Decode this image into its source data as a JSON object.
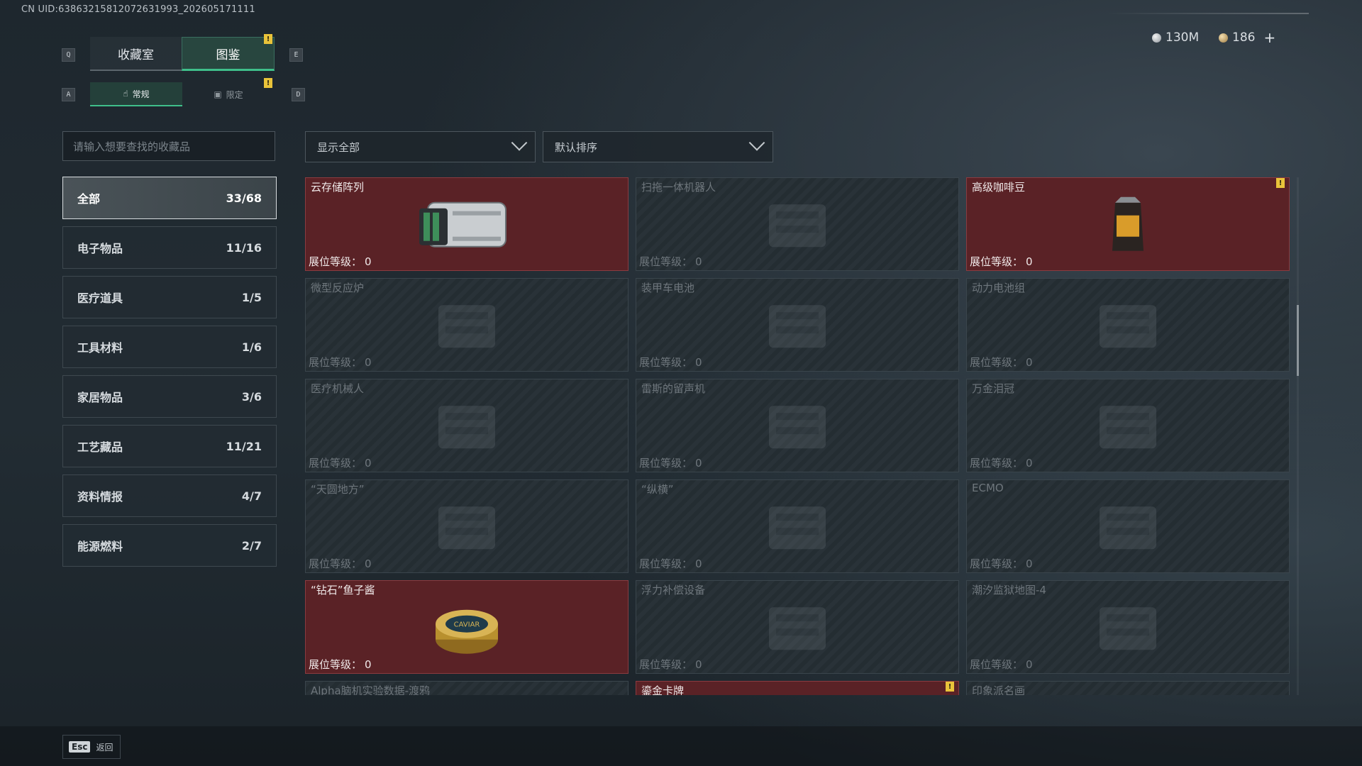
{
  "uid": "CN UID:6386321581207263199​3_202605171111",
  "currency": {
    "silver": "130M",
    "gold": "186",
    "plus": "+"
  },
  "keys": {
    "prev_tab": "Q",
    "next_tab": "E",
    "prev_sub": "A",
    "next_sub": "D"
  },
  "tabs": [
    {
      "label": "收藏室"
    },
    {
      "label": "图鉴"
    }
  ],
  "subtabs": [
    {
      "label": "常规"
    },
    {
      "label": "限定"
    }
  ],
  "badge_mark": "!",
  "search": {
    "placeholder": "请输入想要查找的收藏品"
  },
  "filter": {
    "value": "显示全部"
  },
  "sort": {
    "value": "默认排序"
  },
  "categories": [
    {
      "label": "全部",
      "count": "33/68"
    },
    {
      "label": "电子物品",
      "count": "11/16"
    },
    {
      "label": "医疗道具",
      "count": "1/5"
    },
    {
      "label": "工具材料",
      "count": "1/6"
    },
    {
      "label": "家居物品",
      "count": "3/6"
    },
    {
      "label": "工艺藏品",
      "count": "11/21"
    },
    {
      "label": "资料情报",
      "count": "4/7"
    },
    {
      "label": "能源燃料",
      "count": "2/7"
    }
  ],
  "level_label": "展位等级：",
  "items": [
    {
      "name": "云存储阵列",
      "level": "0",
      "owned": true,
      "icon": "server-icon"
    },
    {
      "name": "扫拖一体机器人",
      "level": "0",
      "owned": false,
      "icon": "robot-vacuum-icon"
    },
    {
      "name": "高级咖啡豆",
      "level": "0",
      "owned": true,
      "icon": "coffee-bag-icon",
      "badge": true
    },
    {
      "name": "微型反应炉",
      "level": "0",
      "owned": false,
      "icon": "reactor-icon"
    },
    {
      "name": "装甲车电池",
      "level": "0",
      "owned": false,
      "icon": "battery-icon"
    },
    {
      "name": "动力电池组",
      "level": "0",
      "owned": false,
      "icon": "battery-pack-icon"
    },
    {
      "name": "医疗机械人",
      "level": "0",
      "owned": false,
      "icon": "medical-robot-icon"
    },
    {
      "name": "雷斯的留声机",
      "level": "0",
      "owned": false,
      "icon": "gramophone-icon"
    },
    {
      "name": "万金泪冠",
      "level": "0",
      "owned": false,
      "icon": "crown-icon"
    },
    {
      "name": "“天圆地方”",
      "level": "0",
      "owned": false,
      "icon": "globe-icon"
    },
    {
      "name": "“纵横”",
      "level": "0",
      "owned": false,
      "icon": "chessboard-icon"
    },
    {
      "name": "ECMO",
      "level": "0",
      "owned": false,
      "icon": "ecmo-icon"
    },
    {
      "name": "“钻石”鱼子酱",
      "level": "0",
      "owned": true,
      "icon": "caviar-tin-icon",
      "label": "CAVIAR"
    },
    {
      "name": "浮力补偿设备",
      "level": "0",
      "owned": false,
      "icon": "bcd-icon"
    },
    {
      "name": "潮汐监狱地图-4",
      "level": "0",
      "owned": false,
      "icon": "map-icon"
    },
    {
      "name": "Alpha脑机实验数据-渡鸦",
      "level": "",
      "owned": false,
      "icon": "data-icon"
    },
    {
      "name": "鎏金卡牌",
      "level": "",
      "owned": true,
      "icon": "card-icon",
      "badge": true
    },
    {
      "name": "印象派名画",
      "level": "",
      "owned": false,
      "icon": "painting-icon"
    }
  ],
  "footer": {
    "key": "Esc",
    "label": "返回"
  }
}
